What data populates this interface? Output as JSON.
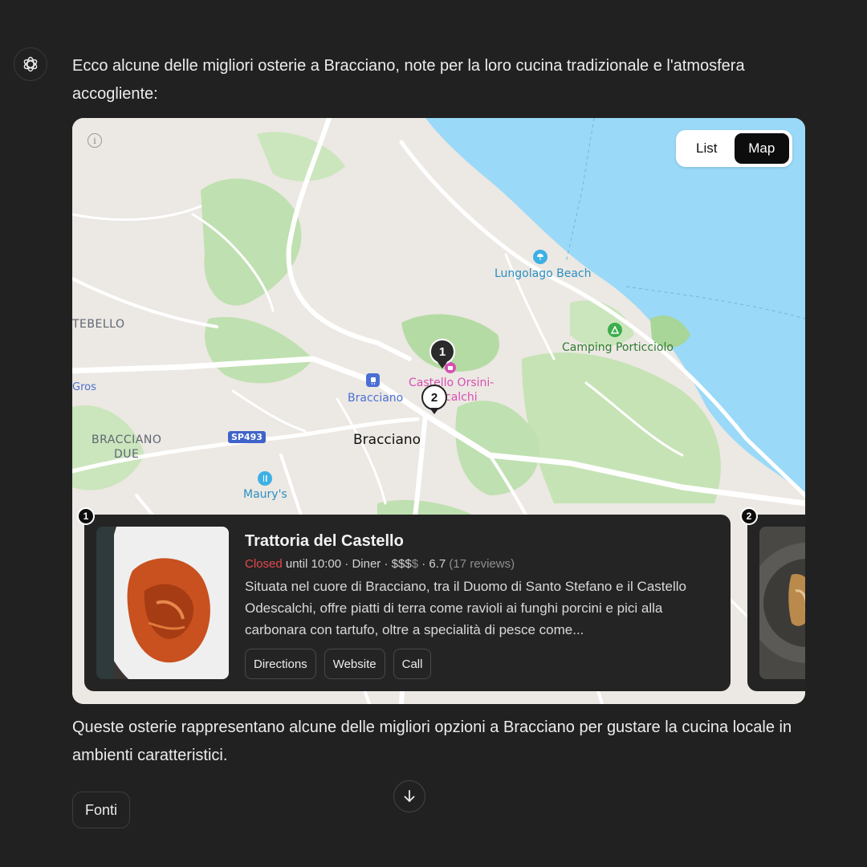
{
  "message": {
    "intro": "Ecco alcune delle migliori osterie a Bracciano, note per la loro cucina tradizionale e l'atmosfera accogliente:",
    "outro": "Queste osterie rappresentano alcune delle migliori opzioni a Bracciano per gustare la cucina locale in ambienti caratteristici."
  },
  "map": {
    "view_toggle": {
      "list_label": "List",
      "map_label": "Map",
      "active": "Map"
    },
    "info_glyph": "i",
    "labels": {
      "beach": "Lungolago Beach",
      "camping": "Camping Porticciolo",
      "castle_line1": "Castello Orsini-",
      "castle_line2": "calchi",
      "station": "Bracciano",
      "town": "Bracciano",
      "road": "SP493",
      "district1": "BRACCIANO",
      "district1b": "DUE",
      "district2": "TEBELLO",
      "partial_left": "Gros",
      "maurys": "Maury's"
    },
    "pins": [
      {
        "number": "1"
      },
      {
        "number": "2"
      }
    ]
  },
  "places": [
    {
      "index": "1",
      "name": "Trattoria del Castello",
      "status": "Closed",
      "hours": "until 10:00",
      "category": "Diner",
      "price_active": "$$$",
      "price_inactive": "$",
      "rating": "6.7",
      "reviews": "(17 reviews)",
      "description": "Situata nel cuore di Bracciano, tra il Duomo di Santo Stefano e il Castello Odescalchi, offre piatti di terra come ravioli ai funghi porcini e pici alla carbonara con tartufo, oltre a specialità di pesce come...",
      "actions": {
        "directions": "Directions",
        "website": "Website",
        "call": "Call"
      }
    },
    {
      "index": "2"
    }
  ],
  "footer": {
    "sources_label": "Fonti"
  },
  "colors": {
    "water": "#9ad9f7",
    "park": "#bfe0b0",
    "land": "#ece8e3",
    "closed": "#e5484d"
  }
}
